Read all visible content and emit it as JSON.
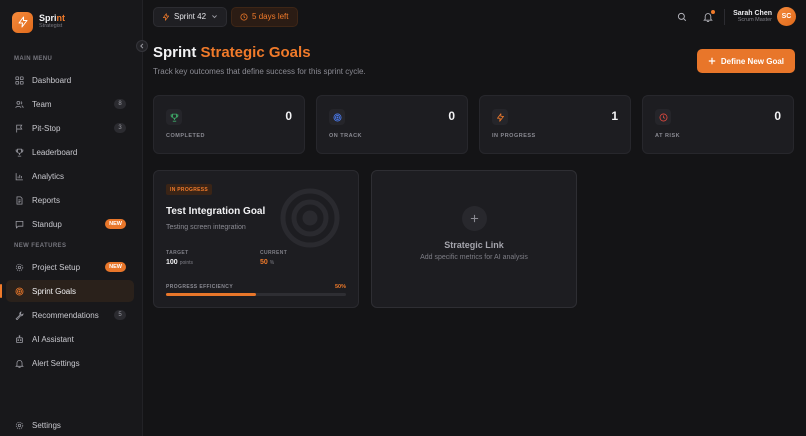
{
  "brand": {
    "name_a": "Spri",
    "name_b": "nt",
    "subtitle": "Strategist"
  },
  "sidebar": {
    "main_menu_label": "MAIN MENU",
    "new_features_label": "NEW FEATURES",
    "items": [
      {
        "label": "Dashboard",
        "icon": "grid-icon"
      },
      {
        "label": "Team",
        "icon": "users-icon",
        "count": "8"
      },
      {
        "label": "Pit-Stop",
        "icon": "flag-icon",
        "count": "3"
      },
      {
        "label": "Leaderboard",
        "icon": "trophy-icon"
      },
      {
        "label": "Analytics",
        "icon": "bar-chart-icon"
      },
      {
        "label": "Reports",
        "icon": "document-icon"
      },
      {
        "label": "Standup",
        "icon": "chat-icon",
        "badge": "NEW"
      }
    ],
    "feature_items": [
      {
        "label": "Project Setup",
        "icon": "cog-icon",
        "badge": "NEW"
      },
      {
        "label": "Sprint Goals",
        "icon": "target-icon",
        "active": true
      },
      {
        "label": "Recommendations",
        "icon": "wrench-icon",
        "count": "5"
      },
      {
        "label": "AI Assistant",
        "icon": "robot-icon"
      },
      {
        "label": "Alert Settings",
        "icon": "bell-icon"
      }
    ],
    "settings_label": "Settings"
  },
  "topbar": {
    "sprint_label": "Sprint 42",
    "days_left": "5 days left",
    "user_name": "Sarah Chen",
    "user_role": "Scrum Master",
    "avatar_initials": "SC"
  },
  "page": {
    "title_a": "Sprint ",
    "title_b": "Strategic Goals",
    "subtitle": "Track key outcomes that define success for this sprint cycle.",
    "define_button": "Define New Goal"
  },
  "stats": [
    {
      "label": "COMPLETED",
      "value": "0",
      "icon": "trophy-icon",
      "color": "#3fae6a"
    },
    {
      "label": "ON TRACK",
      "value": "0",
      "icon": "target-icon",
      "color": "#4a7bf0"
    },
    {
      "label": "IN PROGRESS",
      "value": "1",
      "icon": "bolt-icon",
      "color": "#f07a2a"
    },
    {
      "label": "AT RISK",
      "value": "0",
      "icon": "clock-icon",
      "color": "#e0483f"
    }
  ],
  "goal": {
    "status": "IN PROGRESS",
    "title": "Test Integration Goal",
    "description": "Testing screen integration",
    "target_label": "TARGET",
    "target_value": "100",
    "target_unit": "points",
    "current_label": "CURRENT",
    "current_value": "50",
    "current_unit": "%",
    "efficiency_label": "PROGRESS EFFICIENCY",
    "efficiency_text": "50%",
    "efficiency_fraction": 0.5
  },
  "link_card": {
    "title": "Strategic Link",
    "description": "Add specific metrics for AI analysis"
  },
  "colors": {
    "accent": "#f07a2a",
    "background": "#141416",
    "card": "#1d1d21"
  }
}
